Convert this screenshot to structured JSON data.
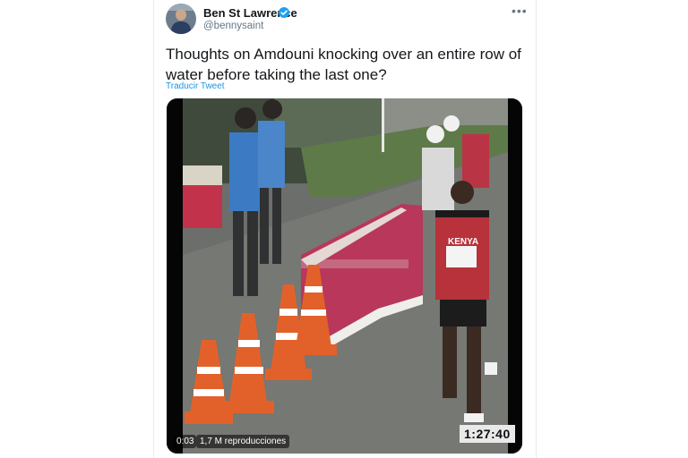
{
  "author": {
    "name": "Ben St Lawrence",
    "handle": "@bennysaint",
    "verified": true
  },
  "tweet": {
    "text": "Thoughts on Amdouni knocking over an entire row of water before taking the last one?",
    "translate_label": "Traducir Tweet"
  },
  "video": {
    "elapsed": "0:03",
    "views": "1,7 M reproducciones",
    "race_clock": "1:27:40",
    "bib_text": "KENYA"
  },
  "icons": {
    "more": "more-options-icon",
    "verified": "verified-badge-icon"
  },
  "colors": {
    "accent": "#1da1f2",
    "link": "#1b95e0",
    "text": "#14171a",
    "muted": "#657786"
  }
}
